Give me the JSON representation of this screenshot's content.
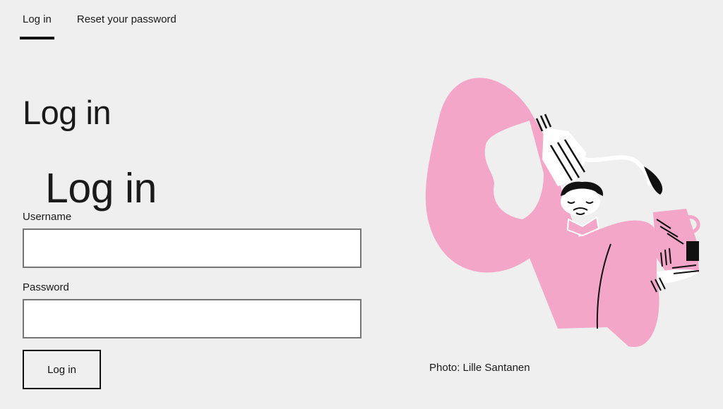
{
  "tabs": {
    "login": "Log in",
    "reset": "Reset your password"
  },
  "page": {
    "title": "Log in"
  },
  "form": {
    "title": "Log in",
    "username_label": "Username",
    "username_value": "",
    "password_label": "Password",
    "password_value": "",
    "submit_label": "Log in"
  },
  "illustration": {
    "icon": "person-pouring-coffee-illustration",
    "accent_color": "#f4a6c8"
  },
  "credit": {
    "text": "Photo: Lille Santanen"
  }
}
